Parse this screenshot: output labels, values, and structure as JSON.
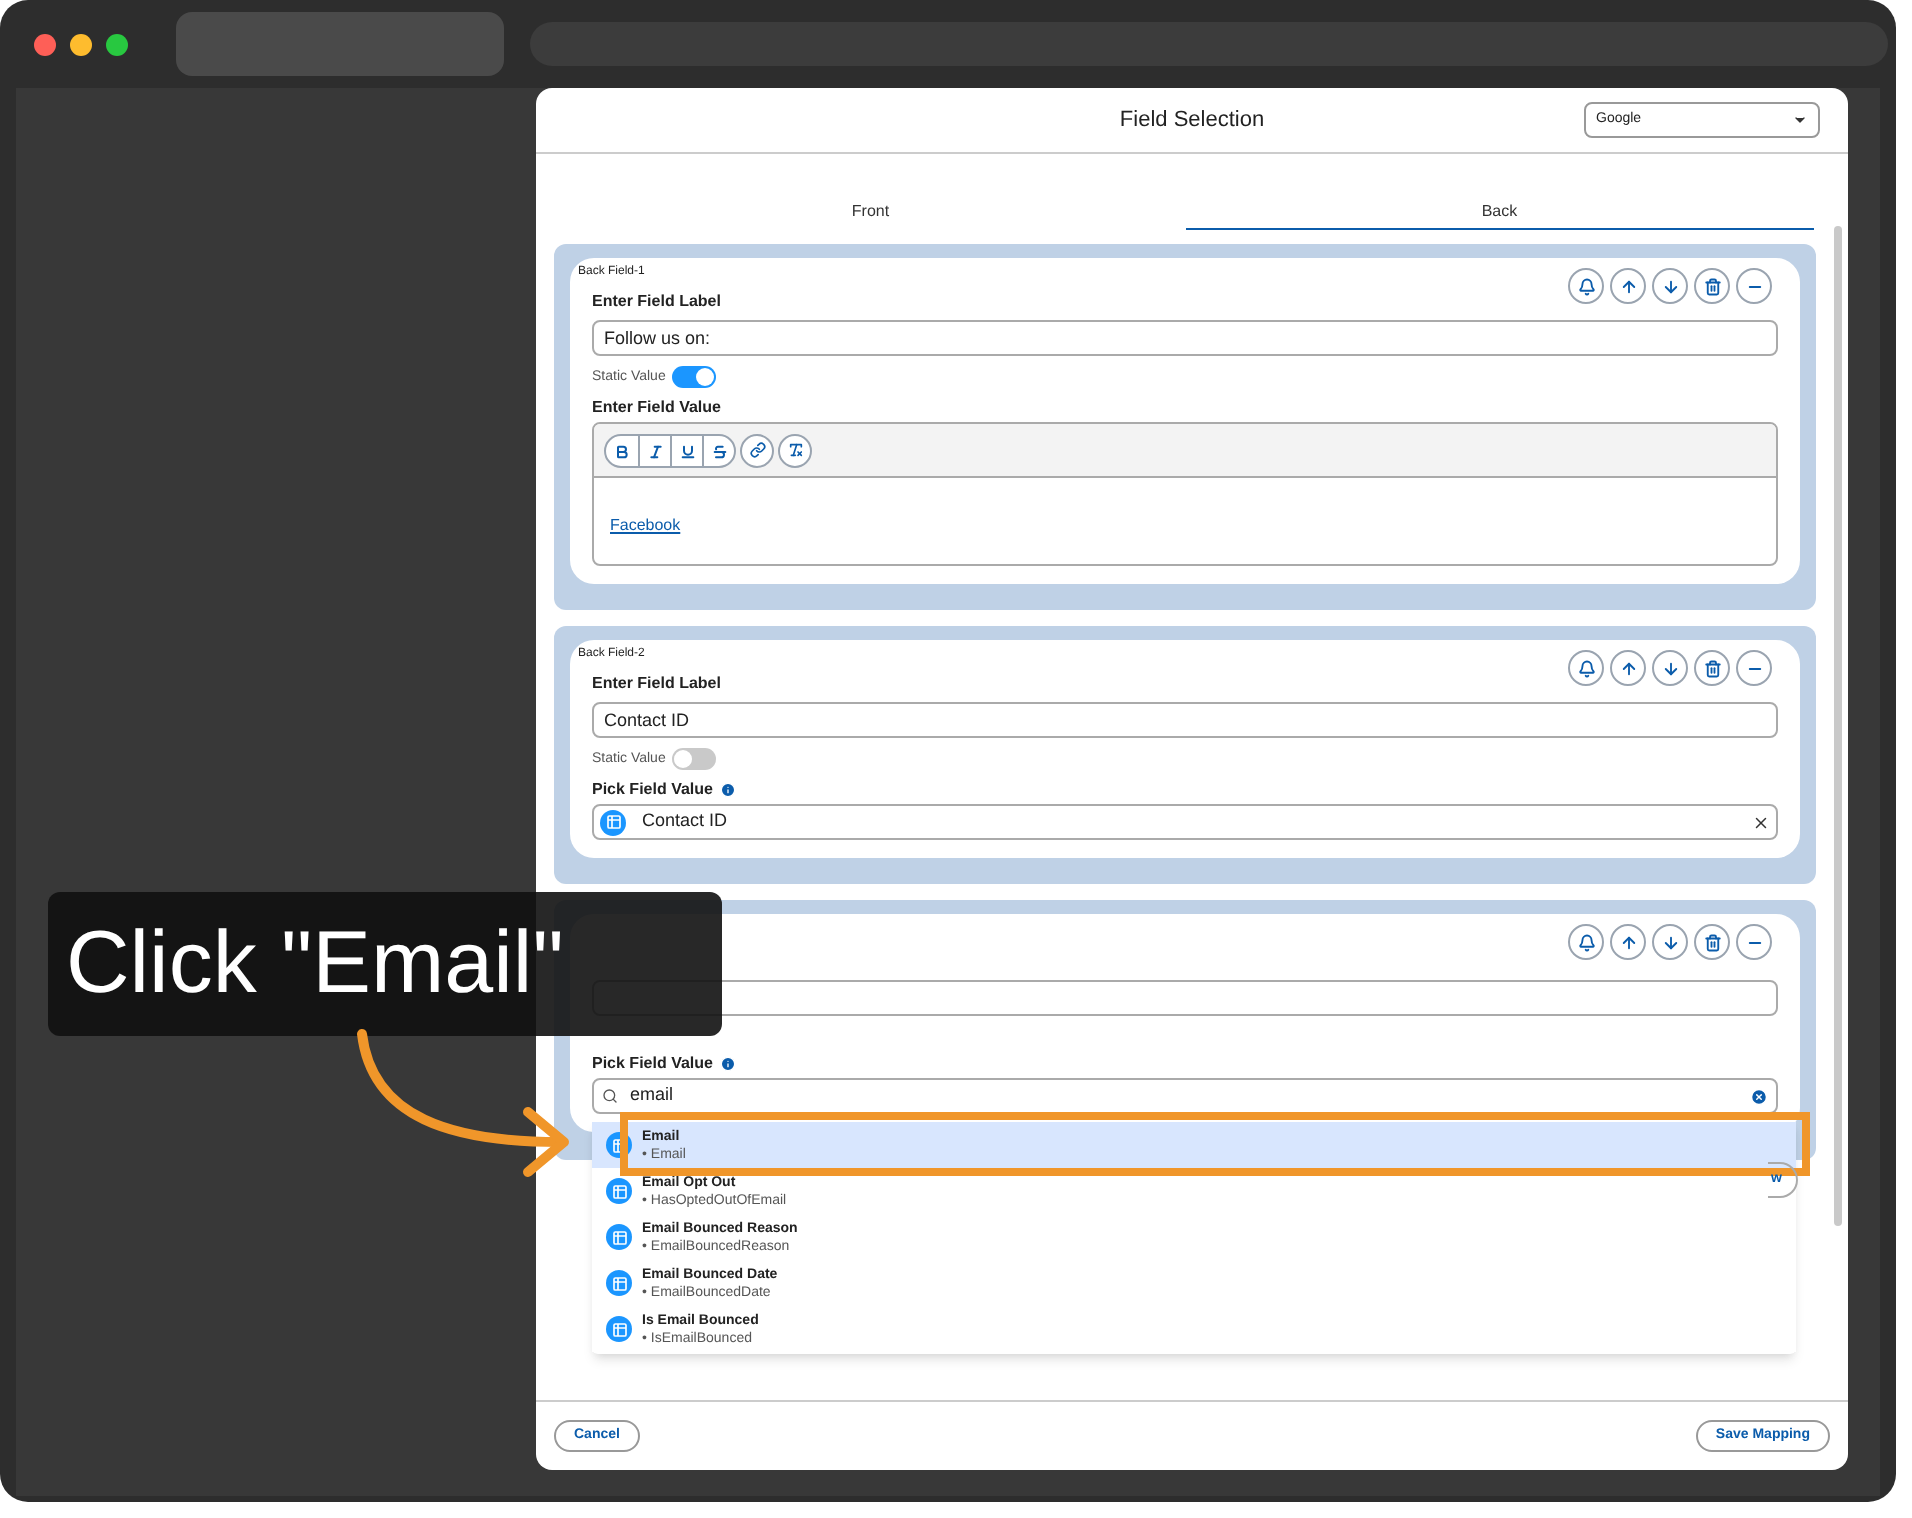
{
  "modal": {
    "title": "Field Selection",
    "source_select": {
      "value": "Google"
    }
  },
  "tabs": [
    {
      "label": "Front",
      "selected": false
    },
    {
      "label": "Back",
      "selected": true
    }
  ],
  "fields": [
    {
      "kind": "static",
      "title": "Back Field-1",
      "label_heading": "Enter Field Label",
      "label_value": "Follow us on:",
      "static_label": "Static Value",
      "static_on": true,
      "value_heading": "Enter Field Value",
      "editor_link": "Facebook"
    },
    {
      "kind": "picked",
      "title": "Back Field-2",
      "label_heading": "Enter Field Label",
      "label_value": "Contact ID",
      "static_label": "Static Value",
      "static_on": false,
      "value_heading": "Pick Field Value",
      "picked_value": "Contact ID"
    },
    {
      "kind": "search",
      "value_heading": "Pick Field Value",
      "search_text": "email",
      "options": [
        {
          "name": "Email",
          "api": "• Email",
          "selected": true
        },
        {
          "name": "Email Opt Out",
          "api": "• HasOptedOutOfEmail",
          "selected": false
        },
        {
          "name": "Email Bounced Reason",
          "api": "• EmailBouncedReason",
          "selected": false
        },
        {
          "name": "Email Bounced Date",
          "api": "• EmailBouncedDate",
          "selected": false
        },
        {
          "name": "Is Email Bounced",
          "api": "• IsEmailBounced",
          "selected": false
        }
      ]
    }
  ],
  "partial_button": "w",
  "footer": {
    "cancel": "Cancel",
    "save": "Save Mapping"
  },
  "annotation": {
    "text": "Click \"Email\""
  }
}
